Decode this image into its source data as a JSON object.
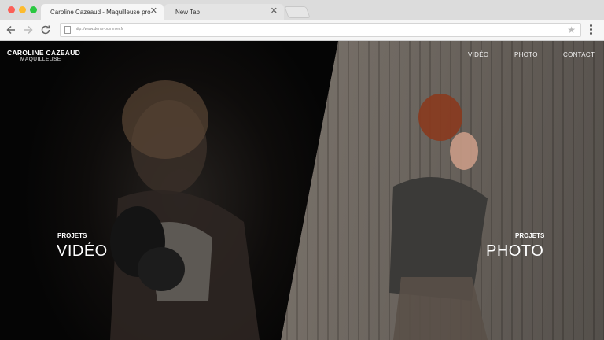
{
  "browser": {
    "tabs": [
      {
        "label": "Caroline Cazeaud - Maquilleuse pro",
        "active": true
      },
      {
        "label": "New Tab",
        "active": false
      }
    ],
    "close_glyph": "✕",
    "url": "http://www.denis-pommier.fr"
  },
  "site": {
    "logo_name": "CAROLINE CAZEAUD",
    "logo_sub": "MAQUILLEUSE",
    "nav": [
      "VIDÉO",
      "PHOTO",
      "CONTACT"
    ],
    "left_panel": {
      "kicker": "PROJETS",
      "title": "VIDÉO"
    },
    "right_panel": {
      "kicker": "PROJETS",
      "title": "PHOTO"
    }
  },
  "icons": {
    "traffic_lights": [
      "#fc5f57",
      "#fdbb2d",
      "#2ac840"
    ],
    "back": "arrow-left-icon",
    "forward": "arrow-right-icon",
    "reload": "reload-icon",
    "bookmark": "star-icon",
    "menu": "kebab-menu-icon"
  }
}
